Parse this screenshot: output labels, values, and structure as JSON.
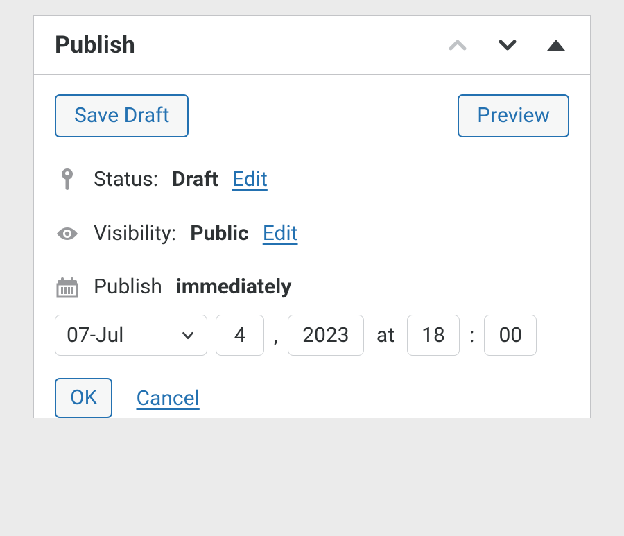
{
  "panel": {
    "title": "Publish"
  },
  "actions": {
    "save_draft": "Save Draft",
    "preview": "Preview"
  },
  "status": {
    "label": "Status:",
    "value": "Draft",
    "edit": "Edit"
  },
  "visibility": {
    "label": "Visibility:",
    "value": "Public",
    "edit": "Edit"
  },
  "publish": {
    "label": "Publish",
    "mode": "immediately"
  },
  "schedule": {
    "month": "07-Jul",
    "day": "4",
    "year": "2023",
    "at": "at",
    "hour": "18",
    "minute": "00",
    "comma": ",",
    "colon": ":"
  },
  "confirm": {
    "ok": "OK",
    "cancel": "Cancel"
  }
}
